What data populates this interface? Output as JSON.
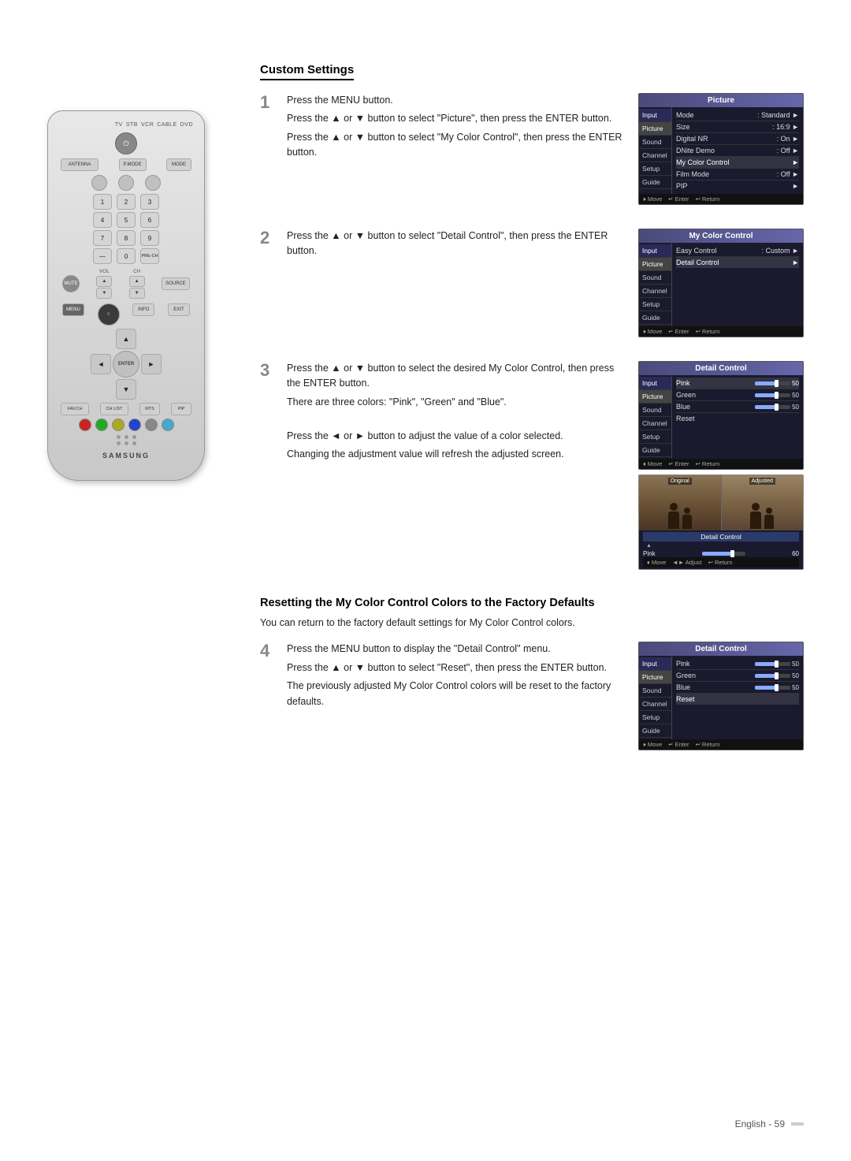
{
  "page": {
    "title": "Custom Settings",
    "reset_title": "Resetting the My Color Control Colors to the Factory Defaults",
    "reset_desc": "You can return to the factory default settings for My Color Control colors.",
    "footer_text": "English - 59"
  },
  "remote": {
    "brand": "SAMSUNG",
    "power_label": "⏻",
    "tv_label": "TV",
    "stb_label": "STB",
    "vcr_label": "VCR",
    "cable_label": "CABLE",
    "dvd_label": "DVD",
    "antenna_label": "ANTENNA",
    "pmode_label": "P.MODE",
    "mode_label": "MODE",
    "num1": "1",
    "num2": "2",
    "num3": "3",
    "num4": "4",
    "num5": "5",
    "num6": "6",
    "num7": "7",
    "num8": "8",
    "num9": "9",
    "num_dash": "—",
    "num0": "0",
    "pre_ch": "PRE-CH",
    "mute_label": "MUTE",
    "vol_label": "VOL",
    "ch_label": "CH",
    "source_label": "SOURCE",
    "nav_up": "▲",
    "nav_down": "▼",
    "nav_left": "◄",
    "nav_right": "►",
    "nav_center": "ENTER",
    "fav_ch": "FAV.CH",
    "ch_list": "CH LIST",
    "mts": "MTS",
    "pip": "PIP",
    "info_label": "INFO"
  },
  "steps": [
    {
      "number": "1",
      "paragraphs": [
        "Press the MENU button.",
        "Press the ▲ or ▼ button to select \"Picture\", then press the ENTER button.",
        "Press the ▲ or ▼ button to select \"My Color Control\", then press the ENTER button."
      ]
    },
    {
      "number": "2",
      "paragraphs": [
        "Press the ▲ or ▼ button to select \"Detail Control\", then press the ENTER button."
      ]
    },
    {
      "number": "3",
      "paragraphs": [
        "Press the ▲ or ▼ button to select the desired My Color Control, then press the ENTER button.",
        "There are three colors: \"Pink\", \"Green\" and \"Blue\".",
        "",
        "Press the ◄ or ► button to adjust the value of a color selected.",
        "Changing the adjustment value will refresh the adjusted screen."
      ]
    },
    {
      "number": "4",
      "paragraphs": [
        "Press the MENU button to display the \"Detail Control\" menu.",
        "Press the ▲ or ▼ button to select \"Reset\", then press the ENTER button.",
        "The previously adjusted My Color Control colors will be reset to the factory defaults."
      ]
    }
  ],
  "tv_panel1": {
    "title": "Picture",
    "sidebar_items": [
      "Input",
      "Picture",
      "Sound",
      "Channel",
      "Setup",
      "Guide"
    ],
    "active_item": "Picture",
    "menu_rows": [
      {
        "label": "Mode",
        "value": ": Standard",
        "has_arrow": true
      },
      {
        "label": "Size",
        "value": ": 16:9",
        "has_arrow": true
      },
      {
        "label": "Digital NR",
        "value": ": On",
        "has_arrow": true
      },
      {
        "label": "DNite Demo",
        "value": ": Off",
        "has_arrow": true
      },
      {
        "label": "My Color Control",
        "value": "",
        "has_arrow": true,
        "highlight": true
      },
      {
        "label": "Film Mode",
        "value": ": Off",
        "has_arrow": true
      },
      {
        "label": "PIP",
        "value": "",
        "has_arrow": true
      }
    ],
    "footer": [
      "♦ Move",
      "↵ Enter",
      "↩ Return"
    ]
  },
  "tv_panel2": {
    "title": "My Color Control",
    "sidebar_items": [
      "Input",
      "Picture",
      "Sound",
      "Channel",
      "Setup",
      "Guide"
    ],
    "active_item": "Picture",
    "menu_rows": [
      {
        "label": "Easy Control",
        "value": ": Custom",
        "has_arrow": true
      },
      {
        "label": "Detail Control",
        "value": "",
        "has_arrow": true,
        "highlight": true
      }
    ],
    "footer": [
      "♦ Move",
      "↵ Enter",
      "↩ Return"
    ]
  },
  "tv_panel3": {
    "title": "Detail Control",
    "sidebar_items": [
      "Input",
      "Picture",
      "Sound",
      "Channel",
      "Setup",
      "Guide"
    ],
    "active_item": "Picture",
    "sliders": [
      {
        "label": "Pink",
        "value": 50
      },
      {
        "label": "Green",
        "value": 50
      },
      {
        "label": "Blue",
        "value": 50
      }
    ],
    "reset_label": "Reset",
    "footer": [
      "♦ Move",
      "↵ Enter",
      "↩ Return"
    ]
  },
  "screen_preview": {
    "original_label": "Original",
    "adjusted_label": "Adjusted",
    "panel_title": "Detail Control",
    "slider_label": "Pink",
    "slider_value": "60",
    "footer": [
      "♦ Move",
      "◄► Adjust",
      "↩ Return"
    ]
  },
  "tv_panel4": {
    "title": "Detail Control",
    "sidebar_items": [
      "Input",
      "Picture",
      "Sound",
      "Channel",
      "Setup",
      "Guide"
    ],
    "active_item": "Picture",
    "sliders": [
      {
        "label": "Pink",
        "value": 50
      },
      {
        "label": "Green",
        "value": 50
      },
      {
        "label": "Blue",
        "value": 50
      }
    ],
    "reset_label": "Reset",
    "reset_highlighted": true,
    "footer": [
      "♦ Move",
      "↵ Enter",
      "↩ Return"
    ]
  }
}
